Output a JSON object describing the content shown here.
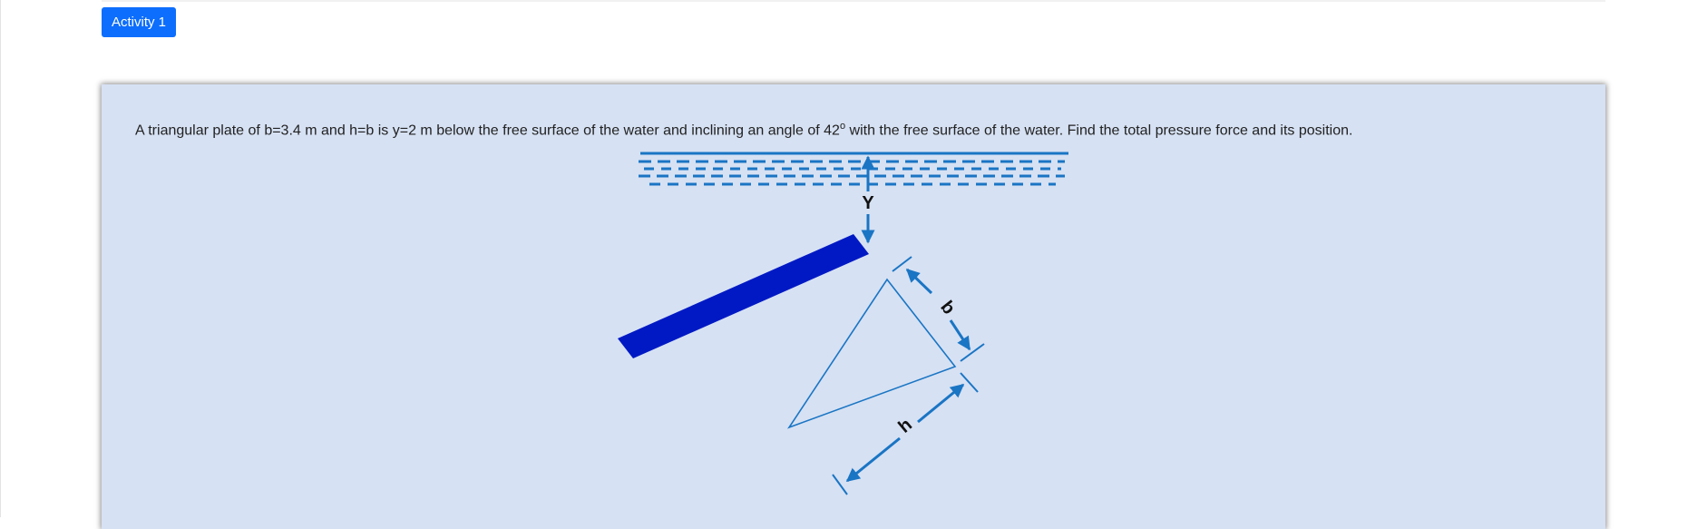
{
  "header": {
    "activity_button_label": "Activity 1"
  },
  "question": {
    "text_before_superscript": "A triangular plate of b=3.4 m and h=b is y=2 m below the free surface of the water and inclining an angle of 42",
    "superscript": "o",
    "text_after_superscript": " with the free surface of the water. Find the total pressure force and its position."
  },
  "diagram": {
    "labels": {
      "depth": "Y",
      "base": "b",
      "height": "h"
    },
    "colors": {
      "card_background": "#d6e1f3",
      "water_lines": "#1a75c4",
      "plate": "#0019c4",
      "triangle": "#1a75c4",
      "button": "#0d6efd"
    }
  }
}
